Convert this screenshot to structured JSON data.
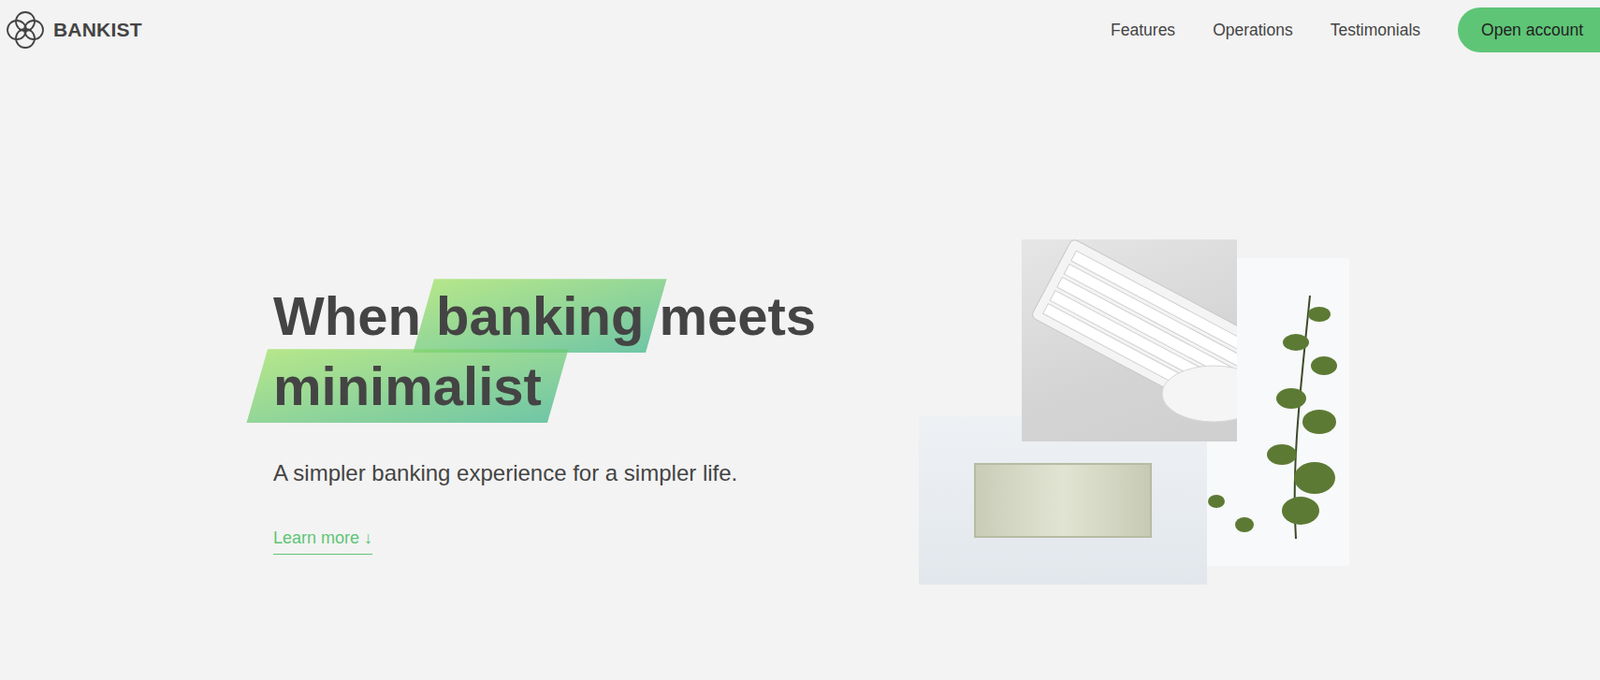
{
  "brand": {
    "name": "BANKIST"
  },
  "nav": {
    "links": [
      "Features",
      "Operations",
      "Testimonials"
    ],
    "cta": "Open account"
  },
  "hero": {
    "title": {
      "lines": [
        [
          {
            "text": "When",
            "highlighted": false
          },
          {
            "text": "banking",
            "highlighted": true
          },
          {
            "text": "meets",
            "highlighted": false
          }
        ],
        [
          {
            "text": "minimalist",
            "highlighted": true
          }
        ]
      ]
    },
    "subtitle": "A simpler banking experience for a simpler life.",
    "learn_more": "Learn more ↓"
  }
}
